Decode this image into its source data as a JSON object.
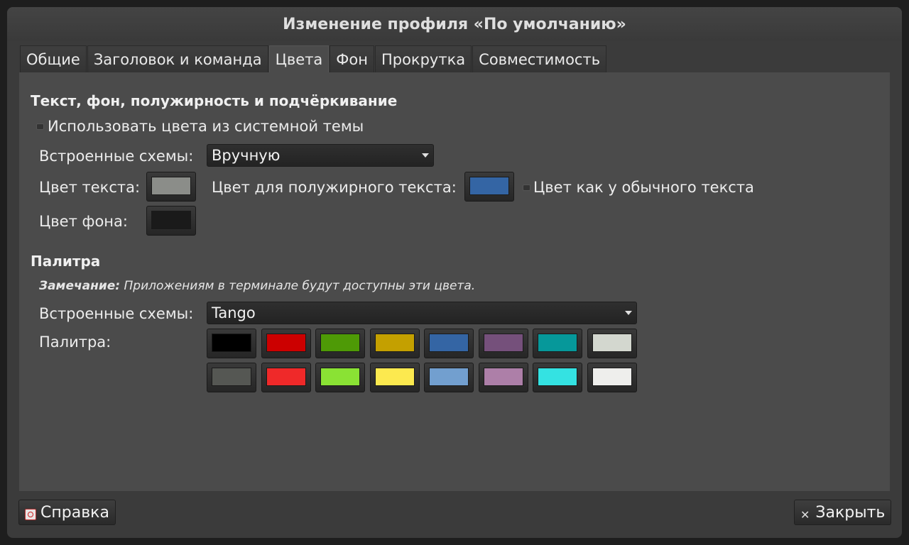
{
  "window": {
    "title": "Изменение профиля «По умолчанию»"
  },
  "tabs": [
    {
      "label": "Общие"
    },
    {
      "label": "Заголовок и команда"
    },
    {
      "label": "Цвета",
      "active": true
    },
    {
      "label": "Фон"
    },
    {
      "label": "Прокрутка"
    },
    {
      "label": "Совместимость"
    }
  ],
  "colors_section": {
    "heading": "Текст, фон, полужирность и подчёркивание",
    "use_system_label": "Использовать цвета из системной темы",
    "schemes_label": "Встроенные схемы:",
    "schemes_value": "Вручную",
    "text_color_label": "Цвет текста:",
    "text_color": "#8b8d89",
    "bold_color_label": "Цвет для полужирного текста:",
    "bold_color": "#3465a4",
    "same_as_text_label": "Цвет как у обычного текста",
    "bg_color_label": "Цвет фона:",
    "bg_color": "#1a1a1a"
  },
  "palette_section": {
    "heading": "Палитра",
    "note_bold": "Замечание:",
    "note_text": " Приложениям в терминале будут доступны эти цвета.",
    "schemes_label": "Встроенные схемы:",
    "schemes_value": "Tango",
    "palette_label": "Палитра:",
    "colors_row1": [
      "#000000",
      "#cc0000",
      "#4e9a06",
      "#c4a000",
      "#3465a4",
      "#75507b",
      "#06989a",
      "#d3d7cf"
    ],
    "colors_row2": [
      "#555753",
      "#ef2929",
      "#8ae234",
      "#fce94f",
      "#729fcf",
      "#ad7fa8",
      "#34e2e2",
      "#eeeeec"
    ]
  },
  "footer": {
    "help_label": "Справка",
    "close_label": "Закрыть"
  }
}
